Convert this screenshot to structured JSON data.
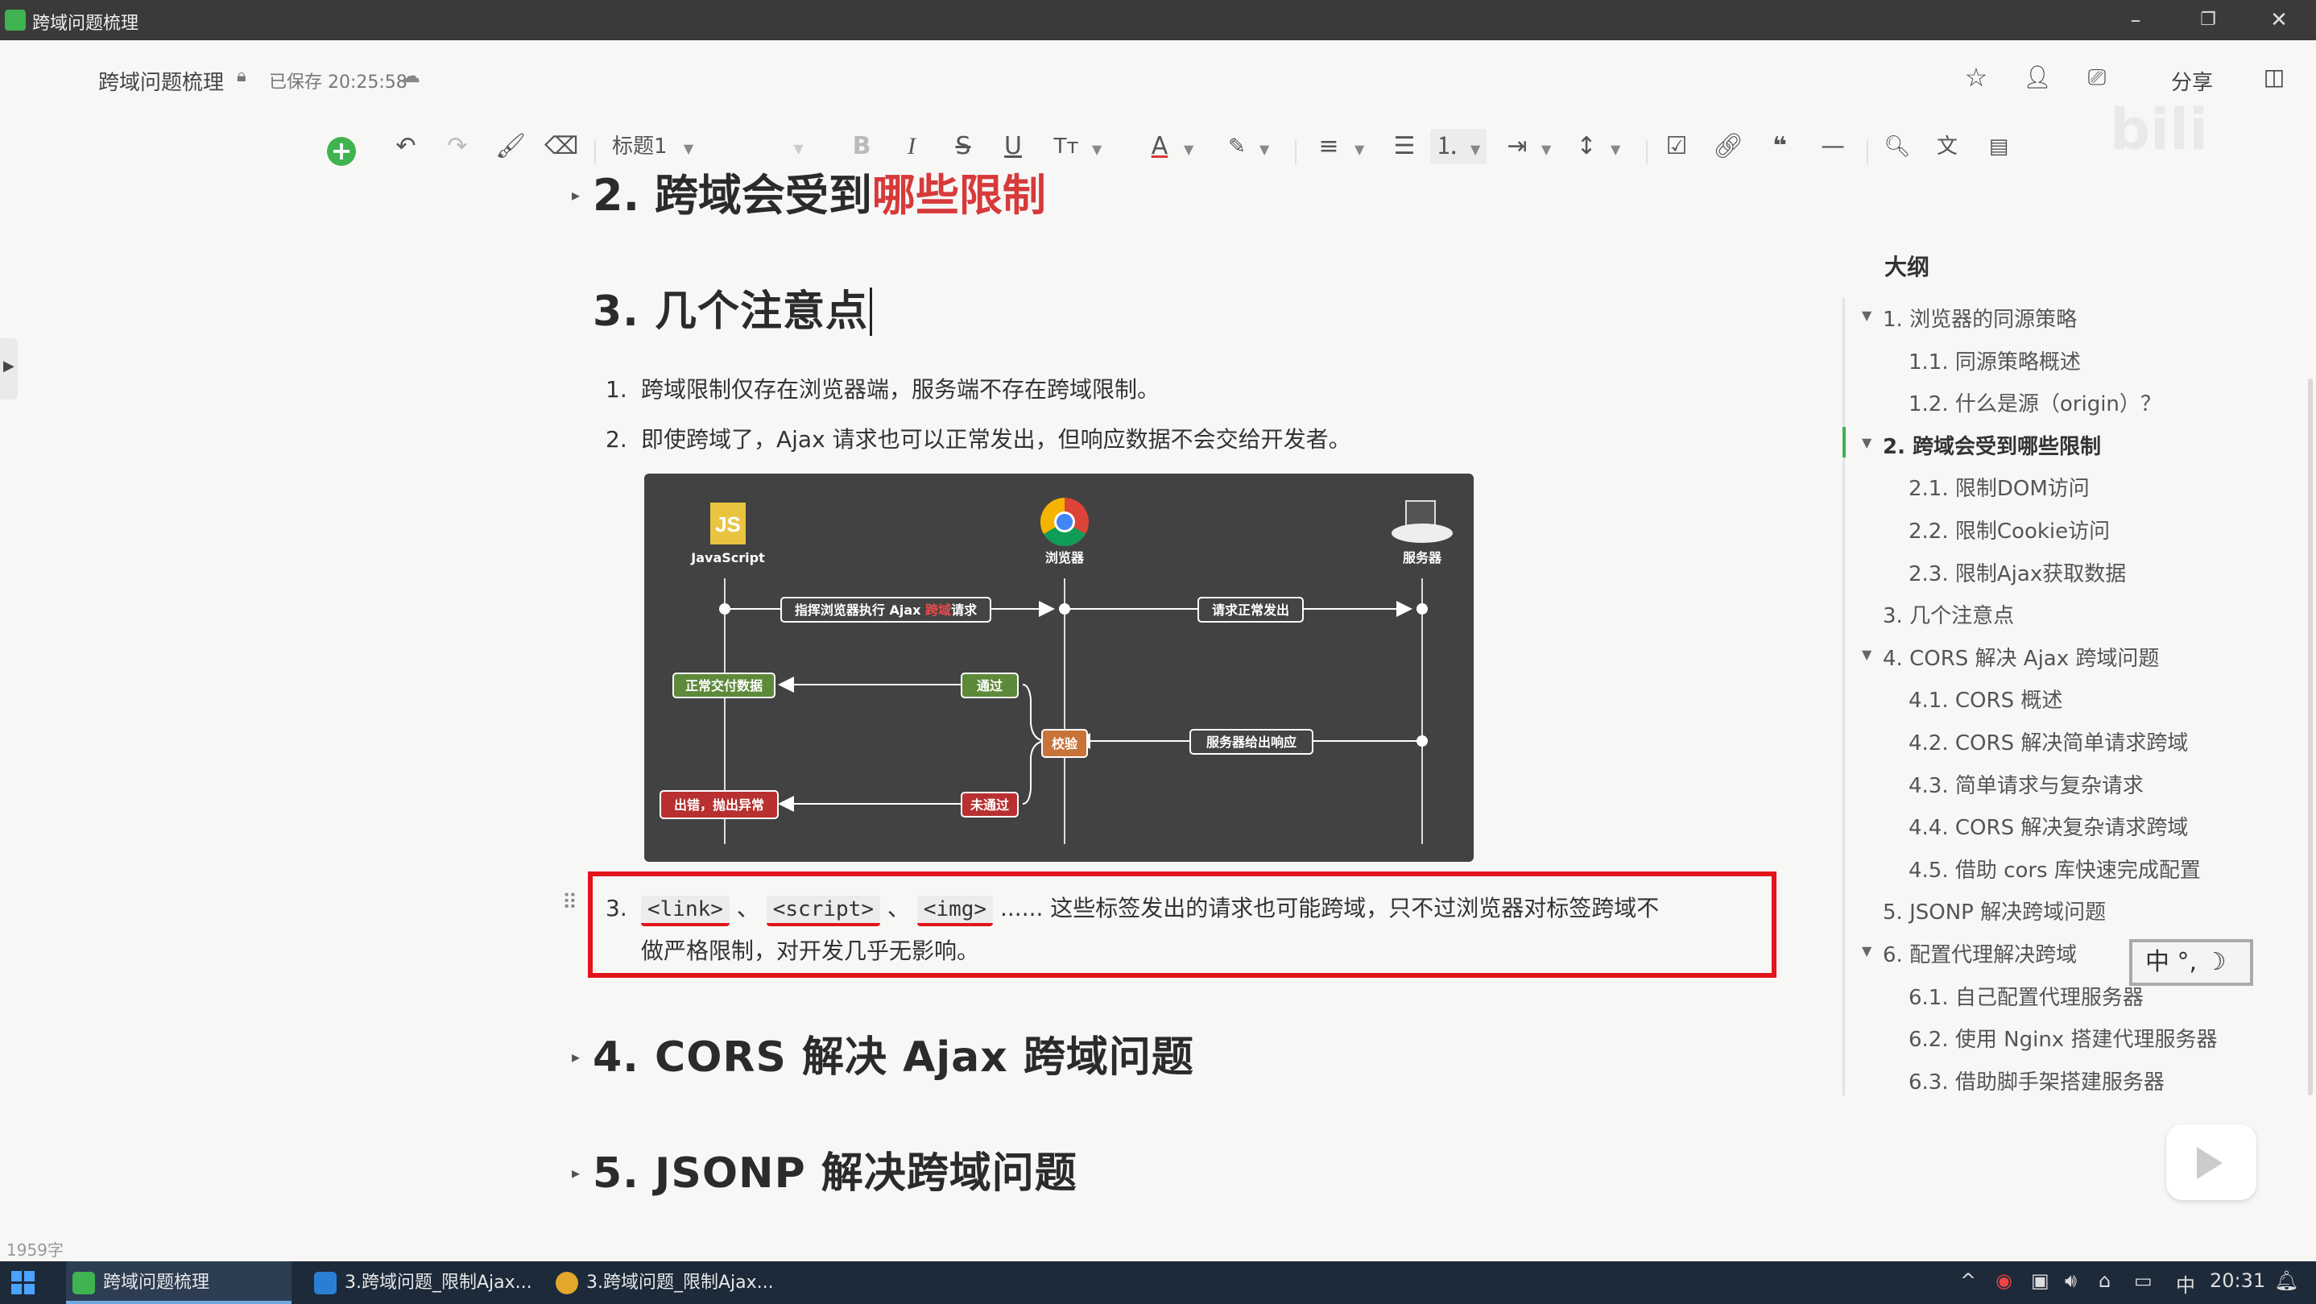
{
  "window": {
    "title": "跨域问题梳理"
  },
  "header": {
    "doc_title": "跨域问题梳理",
    "saved_status": "已保存 20:25:58",
    "share_label": "分享"
  },
  "toolbar": {
    "heading_style": "标题1"
  },
  "editor": {
    "prev_heading_num": "2.",
    "prev_heading_text": "跨域会受到",
    "prev_heading_red": "哪些限制",
    "section3_title": "3. 几个注意点",
    "items": [
      {
        "num": "1.",
        "text": "跨域限制仅存在浏览器端，服务端不存在跨域限制。"
      },
      {
        "num": "2.",
        "text": "即使跨域了，Ajax 请求也可以正常发出，但响应数据不会交给开发者。"
      }
    ],
    "item3": {
      "num": "3.",
      "tags": [
        "<link>",
        "<script>",
        "<img>"
      ],
      "sep": "、",
      "line1_rest": "...... 这些标签发出的请求也可能跨域，只不过浏览器对标签跨域不",
      "line2": "做严格限制，对开发几乎无影响。"
    },
    "section4_title": "4. CORS 解决 Ajax 跨域问题",
    "section5_title": "5. JSONP 解决跨域问题"
  },
  "diagram": {
    "js_label": "JavaScript",
    "browser_label": "浏览器",
    "server_label": "服务器",
    "step_ajax_a": "指挥浏览器执行 Ajax ",
    "step_ajax_red": "跨域",
    "step_ajax_b": "请求",
    "step_send": "请求正常发出",
    "step_response": "服务器给出响应",
    "step_check": "校验",
    "step_pass": "通过",
    "step_fail": "未通过",
    "step_deliver": "正常交付数据",
    "step_error": "出错，抛出异常"
  },
  "word_count": "1959字",
  "outline": {
    "title": "大纲",
    "items": [
      {
        "text": "1. 浏览器的同源策略",
        "level": 1,
        "caret": true
      },
      {
        "text": "1.1. 同源策略概述",
        "level": 2
      },
      {
        "text": "1.2. 什么是源（origin）？",
        "level": 2
      },
      {
        "text": "2. 跨域会受到哪些限制",
        "level": 1,
        "caret": true,
        "active": true
      },
      {
        "text": "2.1. 限制DOM访问",
        "level": 2
      },
      {
        "text": "2.2. 限制Cookie访问",
        "level": 2
      },
      {
        "text": "2.3. 限制Ajax获取数据",
        "level": 2
      },
      {
        "text": "3. 几个注意点",
        "level": 1
      },
      {
        "text": "4. CORS 解决 Ajax 跨域问题",
        "level": 1,
        "caret": true
      },
      {
        "text": "4.1. CORS 概述",
        "level": 2
      },
      {
        "text": "4.2. CORS 解决简单请求跨域",
        "level": 2
      },
      {
        "text": "4.3. 简单请求与复杂请求",
        "level": 2
      },
      {
        "text": "4.4. CORS 解决复杂请求跨域",
        "level": 2
      },
      {
        "text": "4.5. 借助 cors 库快速完成配置",
        "level": 2
      },
      {
        "text": "5. JSONP 解决跨域问题",
        "level": 1
      },
      {
        "text": "6. 配置代理解决跨域",
        "level": 1,
        "caret": true
      },
      {
        "text": "6.1. 自己配置代理服务器",
        "level": 2
      },
      {
        "text": "6.2. 使用 Nginx 搭建代理服务器",
        "level": 2
      },
      {
        "text": "6.3. 借助脚手架搭建服务器",
        "level": 2
      }
    ]
  },
  "ime": {
    "label": "中 °, ☽"
  },
  "taskbar": {
    "tasks": [
      {
        "label": "跨域问题梳理",
        "color": "#3fb34f"
      },
      {
        "label": "3.跨域问题_限制Ajax...",
        "color": "#2a7fd4"
      },
      {
        "label": "3.跨域问题_限制Ajax...",
        "color": "#e2a72b"
      }
    ],
    "ime_indicator": "中",
    "clock": "20:31"
  }
}
